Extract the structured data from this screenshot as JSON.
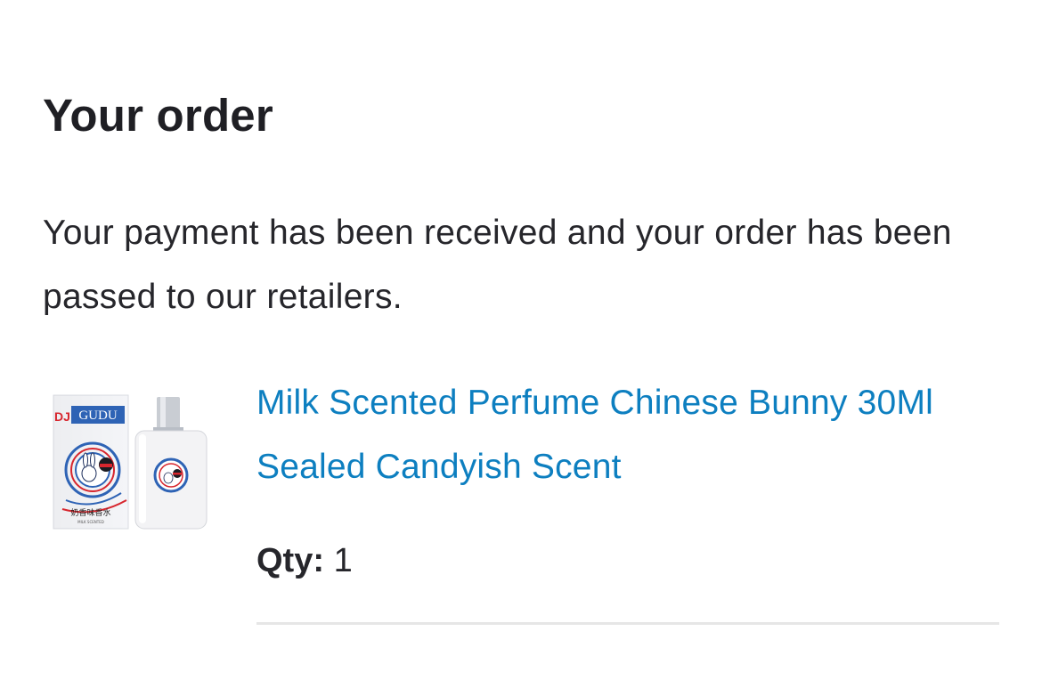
{
  "order": {
    "heading": "Your order",
    "message": "Your payment has been received and your order has been passed to our retailers."
  },
  "item": {
    "title": "Milk Scented Perfume Chinese Bunny 30Ml Sealed Candyish Scent",
    "qty_label": "Qty:",
    "qty_value": "1",
    "image": {
      "brand_text": "GUDU",
      "brand_mark": "DJ",
      "box_caption": "奶香味香水",
      "box_subcaption": "MILK SCENTED"
    }
  },
  "colors": {
    "link": "#0d7fc0",
    "text": "#1f1f24",
    "divider": "#e6e6e6"
  }
}
